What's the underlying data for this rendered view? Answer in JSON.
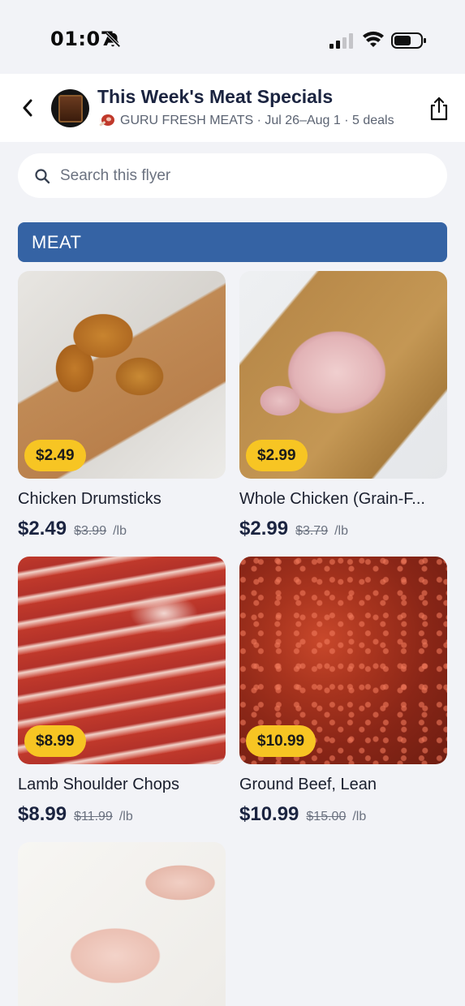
{
  "status_bar": {
    "time": "01:07",
    "icons": [
      "bell-slash-icon",
      "cellular-signal-icon",
      "wifi-icon",
      "battery-icon"
    ]
  },
  "header": {
    "title": "This Week's Meat Specials",
    "subtitle": "GURU FRESH MEATS · Jul 26–Aug 1 · 5 deals",
    "back_icon": "chevron-left-icon",
    "share_icon": "share-icon"
  },
  "search": {
    "placeholder": "Search this flyer",
    "value": ""
  },
  "section": {
    "title": "MEAT"
  },
  "products": [
    {
      "name": "Chicken Drumsticks",
      "badge": "$2.49",
      "price": "$2.49",
      "old_price": "$3.99",
      "unit": "/lb"
    },
    {
      "name": "Whole Chicken (Grain-F...",
      "badge": "$2.99",
      "price": "$2.99",
      "old_price": "$3.79",
      "unit": "/lb"
    },
    {
      "name": "Lamb Shoulder Chops",
      "badge": "$8.99",
      "price": "$8.99",
      "old_price": "$11.99",
      "unit": "/lb"
    },
    {
      "name": "Ground Beef, Lean",
      "badge": "$10.99",
      "price": "$10.99",
      "old_price": "$15.00",
      "unit": "/lb"
    }
  ],
  "colors": {
    "accent": "#3563a4",
    "badge": "#f7c523",
    "background": "#f2f3f7"
  }
}
